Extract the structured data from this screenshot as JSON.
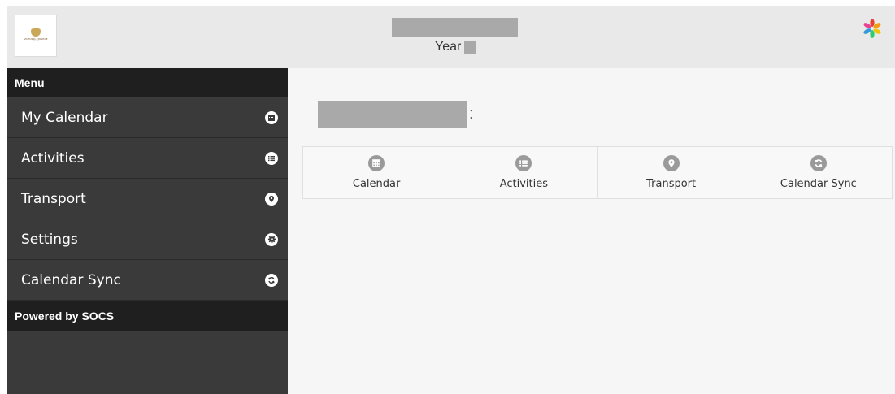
{
  "header": {
    "year_label": "Year",
    "logo_text": "VICTORIA COLLEGE",
    "logo_subtext": "BELFAST"
  },
  "sidebar": {
    "heading": "Menu",
    "items": [
      {
        "label": "My Calendar",
        "icon": "calendar-icon"
      },
      {
        "label": "Activities",
        "icon": "list-icon"
      },
      {
        "label": "Transport",
        "icon": "map-pin-icon"
      },
      {
        "label": "Settings",
        "icon": "gear-icon"
      },
      {
        "label": "Calendar Sync",
        "icon": "sync-icon"
      }
    ],
    "footer": "Powered by SOCS"
  },
  "main": {
    "title_suffix": ":",
    "tiles": [
      {
        "label": "Calendar",
        "icon": "calendar-icon"
      },
      {
        "label": "Activities",
        "icon": "list-icon"
      },
      {
        "label": "Transport",
        "icon": "map-pin-icon"
      },
      {
        "label": "Calendar Sync",
        "icon": "sync-icon"
      }
    ]
  },
  "colors": {
    "header_bg": "#e9e9e9",
    "sidebar_bg": "#3a3a3a",
    "sidebar_header_bg": "#1f1f1f",
    "main_bg": "#f6f6f6",
    "tile_icon": "#9a9a9a"
  }
}
